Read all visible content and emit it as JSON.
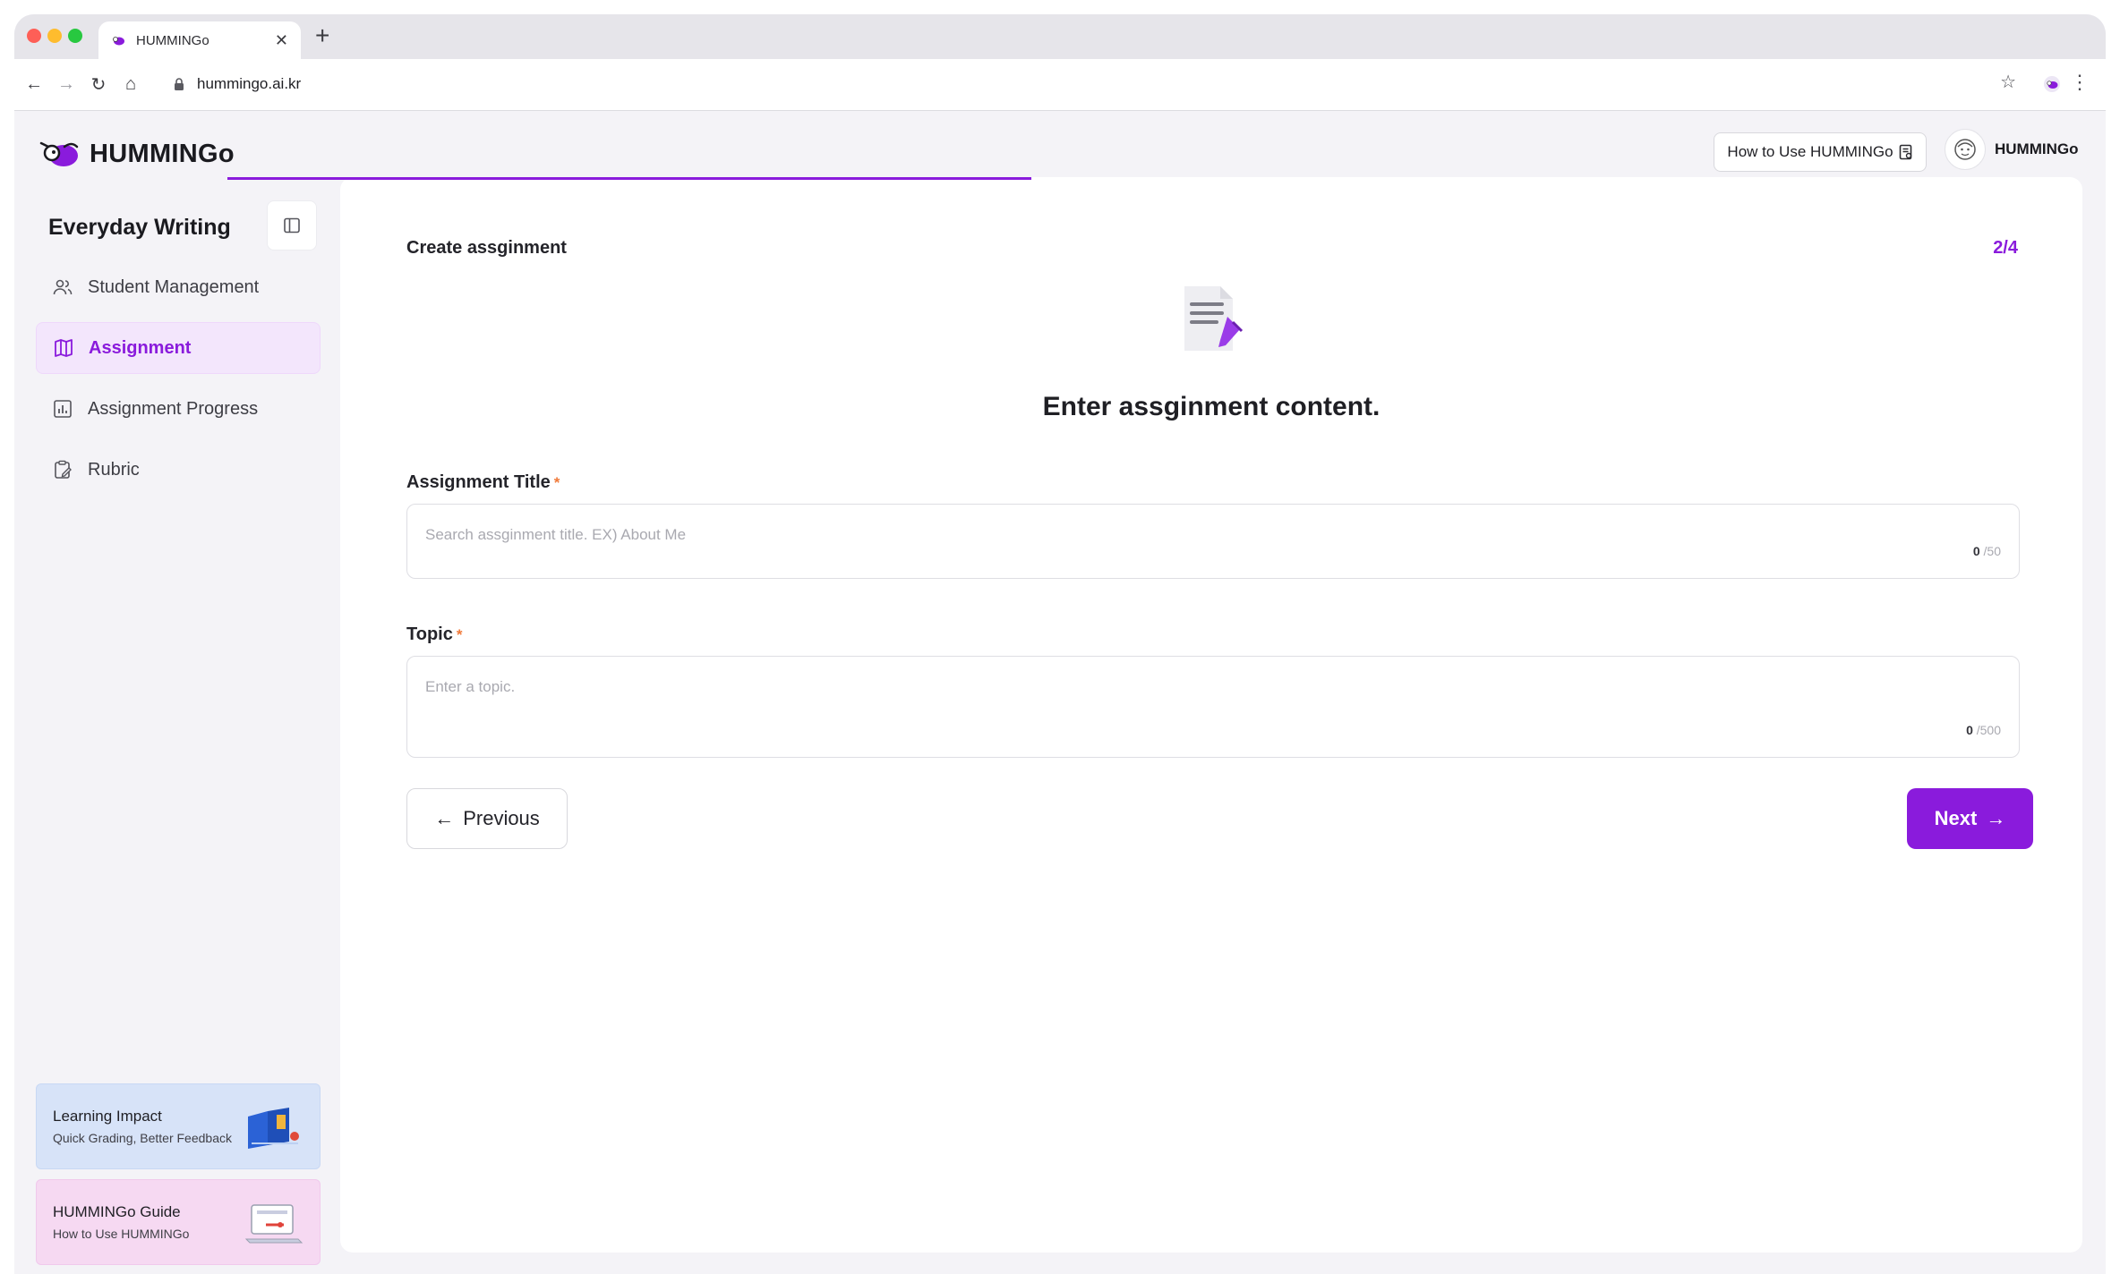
{
  "browser": {
    "tab_title": "HUMMINGo",
    "url": "hummingo.ai.kr"
  },
  "header": {
    "logo_text": "HUMMINGo",
    "howto_label": "How to Use HUMMINGo",
    "profile_name": "HUMMINGo"
  },
  "sidebar": {
    "title": "Everyday Writing",
    "items": [
      {
        "label": "Student Management",
        "icon": "users-icon"
      },
      {
        "label": "Assignment",
        "icon": "book-open-icon",
        "active": true
      },
      {
        "label": "Assignment Progress",
        "icon": "chart-icon"
      },
      {
        "label": "Rubric",
        "icon": "clipboard-icon"
      }
    ],
    "promos": [
      {
        "title": "Learning Impact",
        "subtitle": "Quick Grading, Better Feedback"
      },
      {
        "title": "HUMMINGo Guide",
        "subtitle": "How to Use HUMMINGo"
      }
    ]
  },
  "main": {
    "step_title": "Create assginment",
    "step_count": "2/4",
    "progress_fraction": 0.5,
    "headline": "Enter assginment content.",
    "title_field": {
      "label": "Assignment Title",
      "required_mark": "*",
      "placeholder": "Search assginment title. EX) About Me",
      "count": "0",
      "max": "/50"
    },
    "topic_field": {
      "label": "Topic",
      "required_mark": "*",
      "placeholder": "Enter a topic.",
      "count": "0",
      "max": "/500"
    },
    "prev_label": "Previous",
    "next_label": "Next"
  },
  "colors": {
    "accent": "#8a1bdc",
    "required": "#f07a3a"
  }
}
